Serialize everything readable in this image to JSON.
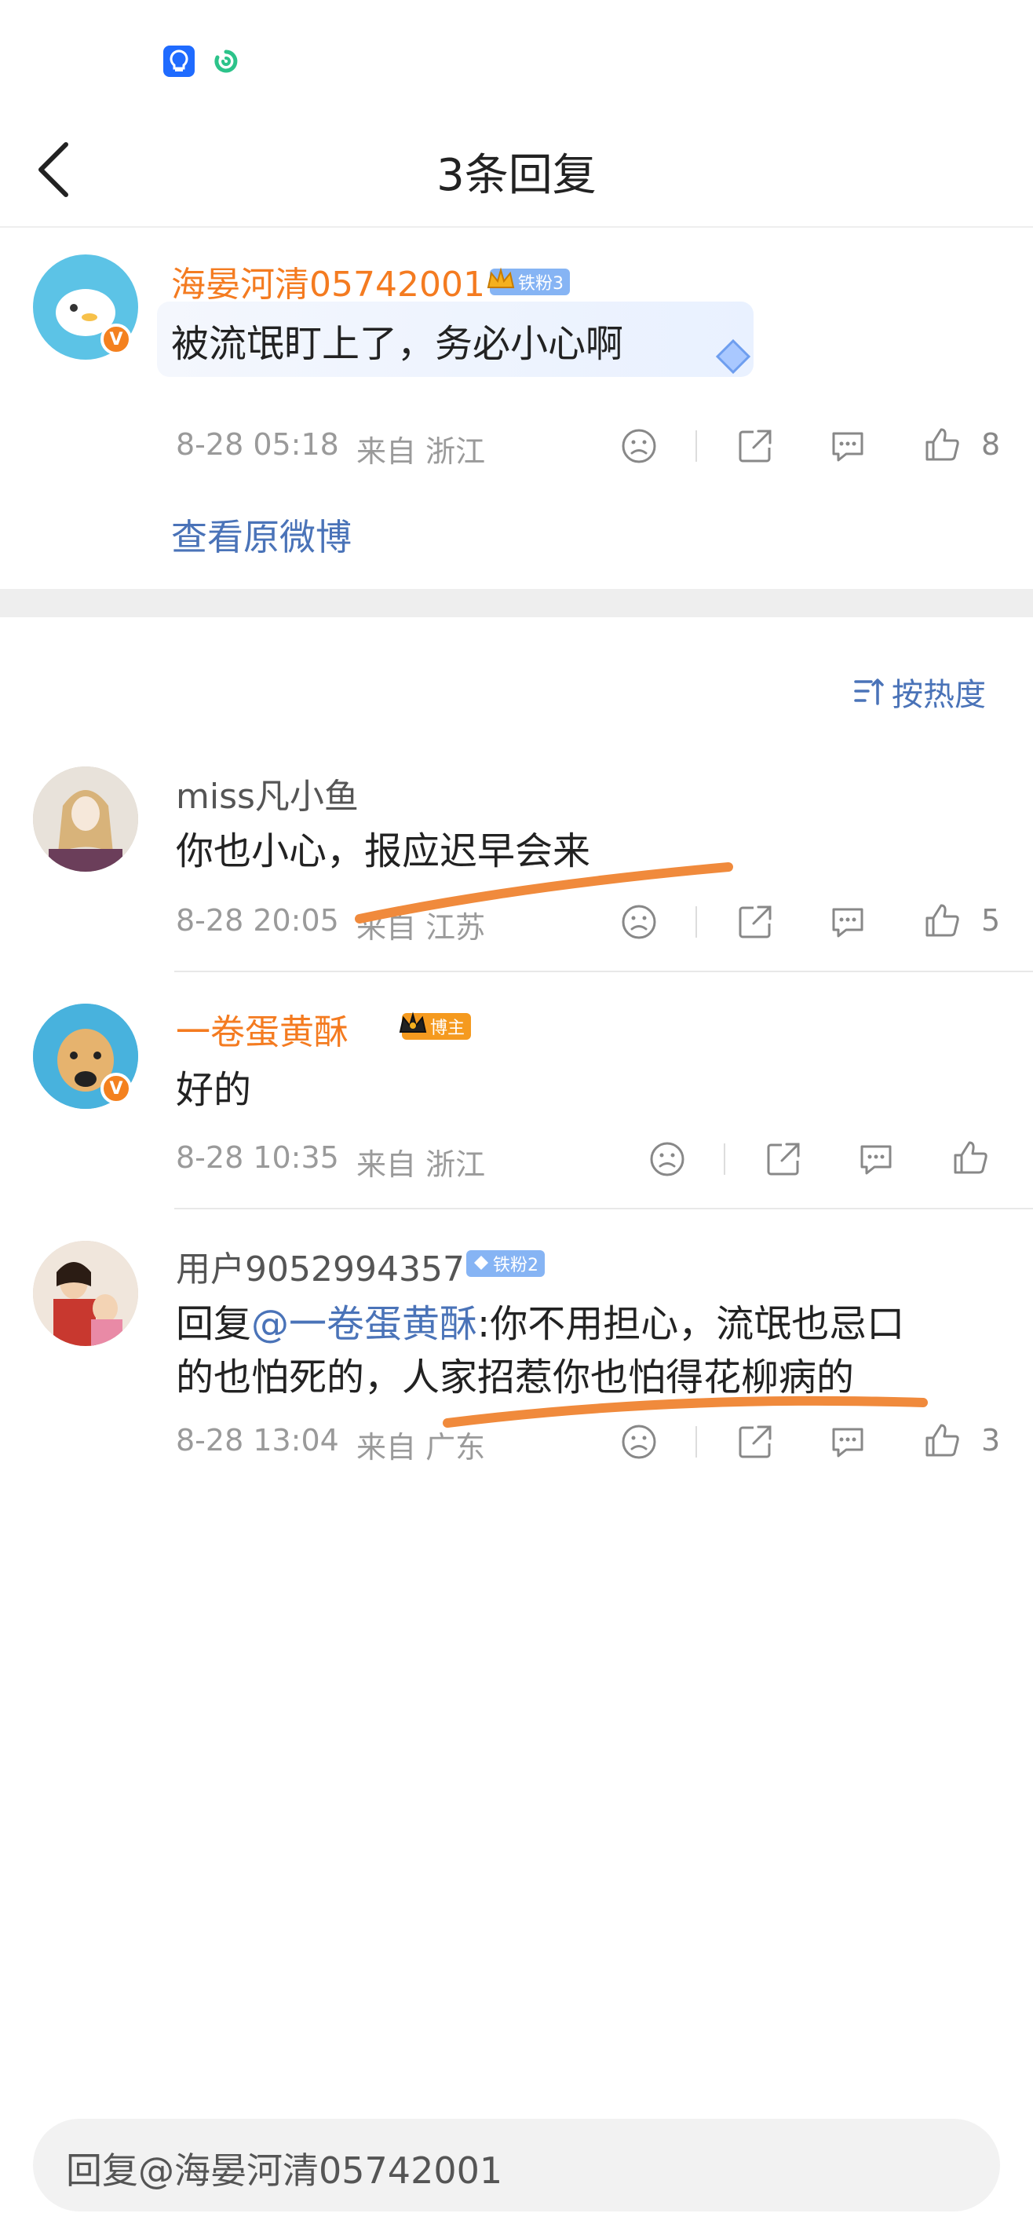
{
  "header": {
    "title": "3条回复",
    "back_label": ""
  },
  "original": {
    "username": "海晏河清05742001",
    "badge": "铁粉3",
    "content": "被流氓盯上了，务必小心啊",
    "time": "8-28 05:18",
    "location": "来自 浙江",
    "likes": "8",
    "view_original": "查看原微博"
  },
  "sort": {
    "label": "按热度"
  },
  "replies": [
    {
      "username": "miss凡小鱼",
      "badge": "",
      "content": "你也小心，报应迟早会来",
      "time": "8-28 20:05",
      "location": "来自 江苏",
      "likes": "5"
    },
    {
      "username": "一卷蛋黄酥",
      "badge": "博主",
      "content": "好的",
      "time": "8-28 10:35",
      "location": "来自 浙江",
      "likes": ""
    },
    {
      "username": "用户9052994357",
      "badge": "铁粉2",
      "content_prefix": "回复",
      "content_mention": "@一卷蛋黄酥",
      "content_line1": ":你不用担心，流氓也忌口",
      "content_line2": "的也怕死的，人家招惹你也怕得花柳病的",
      "time": "8-28 13:04",
      "location": "来自 广东",
      "likes": "3"
    }
  ],
  "reply_bar": {
    "placeholder": "回复@海晏河清05742001"
  },
  "icons": {
    "status": [
      "lightbulb-app-icon",
      "green-swirl-app-icon"
    ],
    "actions": [
      "sad-face-icon",
      "share-icon",
      "comment-icon",
      "thumbs-up-icon"
    ]
  },
  "colors": {
    "accent_blue": "#4a73b8",
    "username_orange": "#f47b20",
    "highlight_orange": "#f08a3c",
    "verified_orange": "#f4811f"
  }
}
